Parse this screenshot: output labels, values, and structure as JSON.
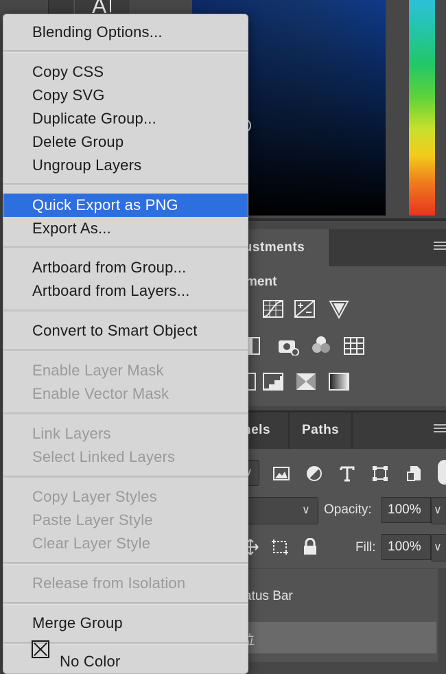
{
  "background": {
    "type_tool_glyph": "A",
    "adjustments_tab": "justments",
    "adjustments_heading": "ment",
    "layers_tab_channels": "nels",
    "layers_tab_paths": "Paths",
    "opacity_label": "Opacity:",
    "opacity_value": "100%",
    "fill_label": "Fill:",
    "fill_value": "100%",
    "layer_row1_name": "atus Bar",
    "layer_row2_name": "位"
  },
  "menu": {
    "items": [
      {
        "label": "Blending Options...",
        "enabled": true
      },
      {
        "label": "Copy CSS",
        "enabled": true
      },
      {
        "label": "Copy SVG",
        "enabled": true
      },
      {
        "label": "Duplicate Group...",
        "enabled": true
      },
      {
        "label": "Delete Group",
        "enabled": true
      },
      {
        "label": "Ungroup Layers",
        "enabled": true
      },
      {
        "label": "Quick Export as PNG",
        "enabled": true,
        "highlighted": true
      },
      {
        "label": "Export As...",
        "enabled": true
      },
      {
        "label": "Artboard from Group...",
        "enabled": true
      },
      {
        "label": "Artboard from Layers...",
        "enabled": true
      },
      {
        "label": "Convert to Smart Object",
        "enabled": true
      },
      {
        "label": "Enable Layer Mask",
        "enabled": false
      },
      {
        "label": "Enable Vector Mask",
        "enabled": false
      },
      {
        "label": "Link Layers",
        "enabled": false
      },
      {
        "label": "Select Linked Layers",
        "enabled": false
      },
      {
        "label": "Copy Layer Styles",
        "enabled": false
      },
      {
        "label": "Paste Layer Style",
        "enabled": false
      },
      {
        "label": "Clear Layer Style",
        "enabled": false
      },
      {
        "label": "Release from Isolation",
        "enabled": false
      },
      {
        "label": "Merge Group",
        "enabled": true
      },
      {
        "label": "No Color",
        "enabled": true,
        "checked": true
      }
    ]
  },
  "colors": {
    "menu_bg": "#d6d6d6",
    "highlight": "#2e6fe0",
    "disabled_text": "#9a9a9a",
    "panel_bg": "#535353"
  }
}
